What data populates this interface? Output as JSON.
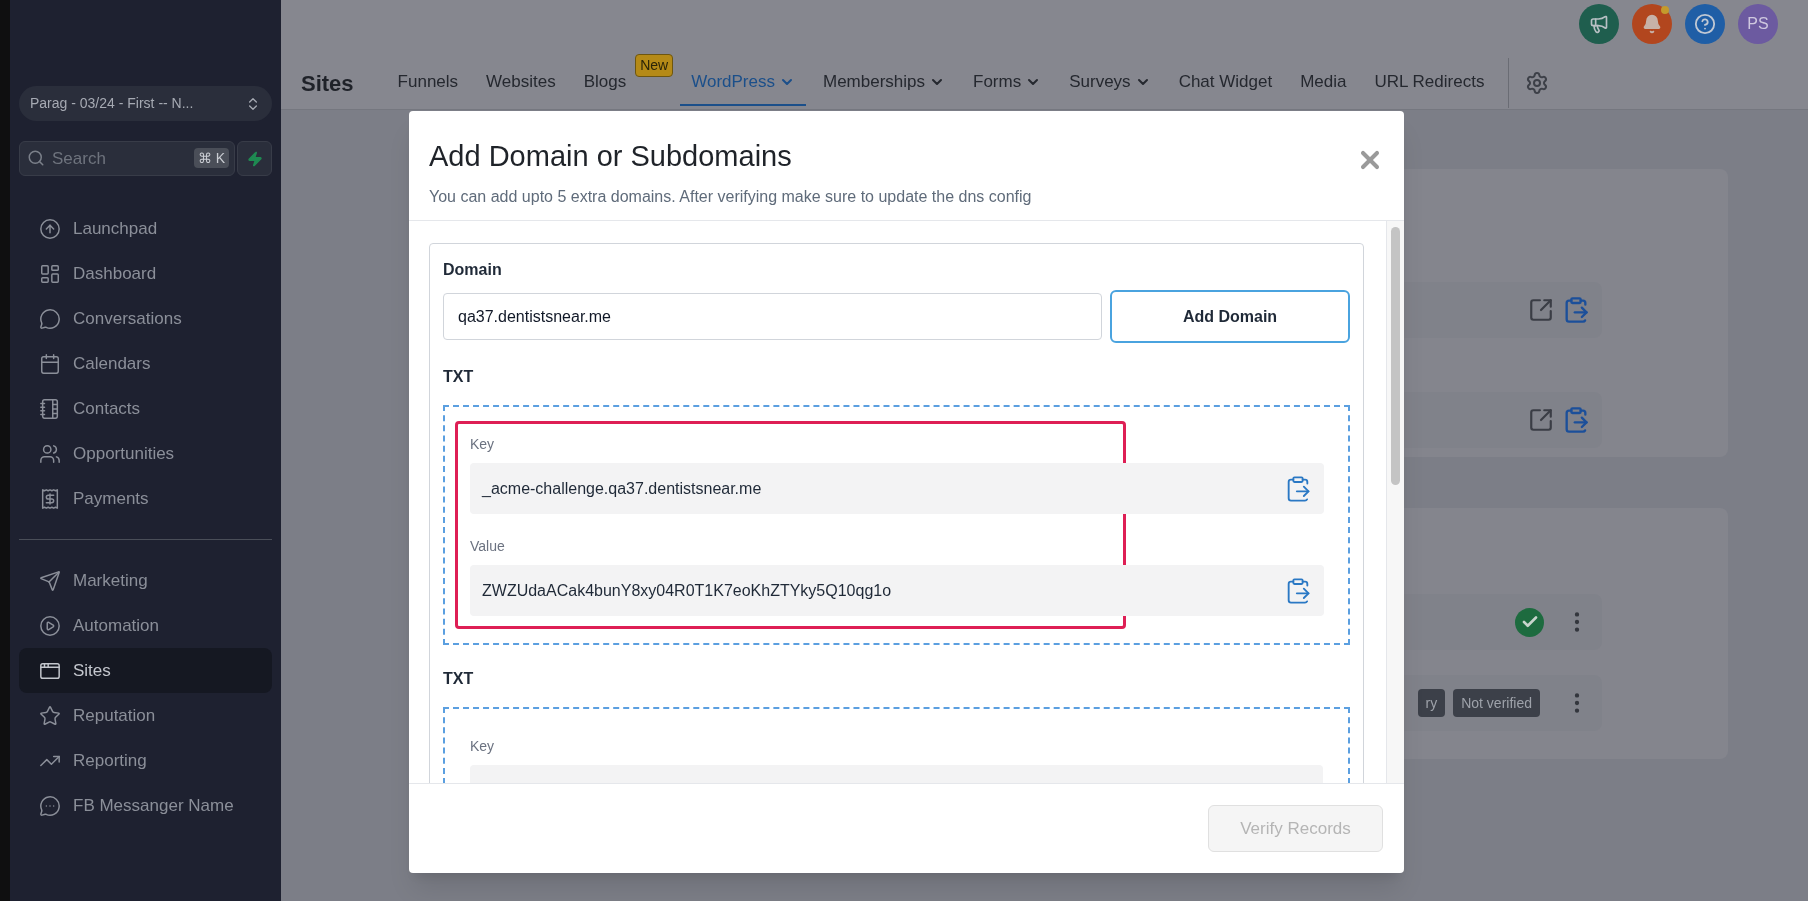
{
  "sidebar": {
    "account": "Parag - 03/24 - First -- N...",
    "search": {
      "placeholder": "Search",
      "shortcut": "⌘ K"
    },
    "groups": [
      {
        "items": [
          {
            "label": "Launchpad",
            "selected": false
          },
          {
            "label": "Dashboard",
            "selected": false
          },
          {
            "label": "Conversations",
            "selected": false
          },
          {
            "label": "Calendars",
            "selected": false
          },
          {
            "label": "Contacts",
            "selected": false
          },
          {
            "label": "Opportunities",
            "selected": false
          },
          {
            "label": "Payments",
            "selected": false
          }
        ]
      },
      {
        "items": [
          {
            "label": "Marketing",
            "selected": false
          },
          {
            "label": "Automation",
            "selected": false
          },
          {
            "label": "Sites",
            "selected": true
          },
          {
            "label": "Reputation",
            "selected": false
          },
          {
            "label": "Reporting",
            "selected": false
          },
          {
            "label": "FB Messanger Name",
            "selected": false
          }
        ]
      }
    ]
  },
  "header": {
    "title": "Sites",
    "avatar": "PS",
    "tabs": [
      {
        "label": "Funnels",
        "selected": false,
        "dropdown": false
      },
      {
        "label": "Websites",
        "selected": false,
        "dropdown": false
      },
      {
        "label": "Blogs",
        "selected": false,
        "dropdown": false,
        "badge": "New"
      },
      {
        "label": "WordPress",
        "selected": true,
        "dropdown": true
      },
      {
        "label": "Memberships",
        "selected": false,
        "dropdown": true
      },
      {
        "label": "Forms",
        "selected": false,
        "dropdown": true
      },
      {
        "label": "Surveys",
        "selected": false,
        "dropdown": true
      },
      {
        "label": "Chat Widget",
        "selected": false,
        "dropdown": false
      },
      {
        "label": "Media",
        "selected": false,
        "dropdown": false
      },
      {
        "label": "URL Redirects",
        "selected": false,
        "dropdown": false
      }
    ]
  },
  "background_rows": [
    {
      "kind": "links"
    },
    {
      "kind": "links"
    },
    {
      "kind": "verified"
    },
    {
      "kind": "status",
      "badges": [
        "ry",
        "Not verified"
      ]
    }
  ],
  "modal": {
    "title": "Add Domain or Subdomains",
    "subtitle": "You can add upto 5 extra domains. After verifying make sure to update the dns config",
    "domain_label": "Domain",
    "domain_value": "qa37.dentistsnear.me",
    "add_button": "Add Domain",
    "records": [
      {
        "type": "TXT",
        "highlighted": true,
        "key_label": "Key",
        "key": "_acme-challenge.qa37.dentistsnear.me",
        "value_label": "Value",
        "value": "ZWZUdaACak4bunY8xy04R0T1K7eoKhZTYky5Q10qg1o"
      },
      {
        "type": "TXT",
        "highlighted": false,
        "key_label": "Key"
      }
    ],
    "verify_button": {
      "label": "Verify Records",
      "disabled": true
    }
  }
}
